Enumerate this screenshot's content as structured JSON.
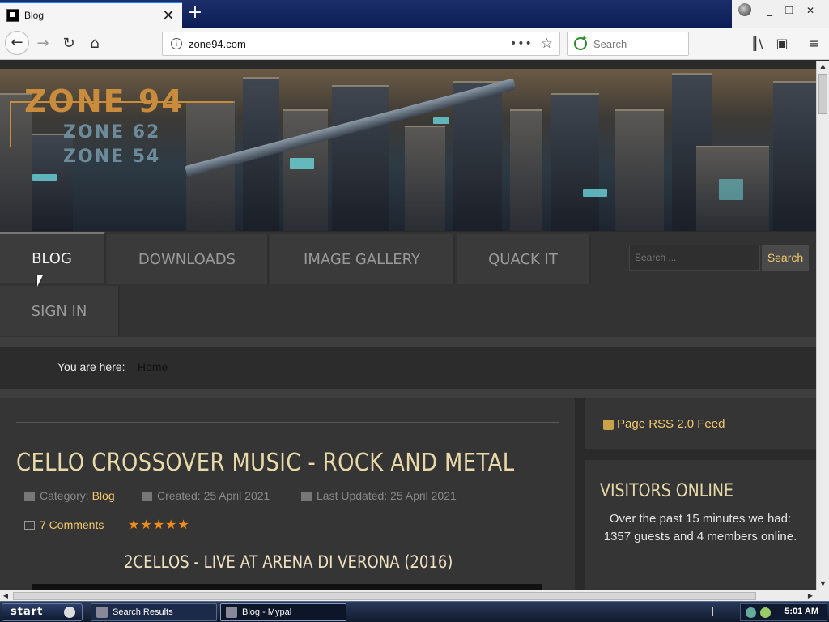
{
  "browser": {
    "tab_title": "Blog",
    "tab_close": "✕",
    "newtab": "+",
    "url": "zone94.com",
    "url_menu": "•••",
    "search_placeholder": "Search",
    "window_controls": [
      "_",
      "❐",
      "✕"
    ]
  },
  "site": {
    "logo": {
      "main": "ZONE 94",
      "sub1": "ZONE 62",
      "sub2": "ZONE 54"
    },
    "menu": [
      "BLOG",
      "DOWNLOADS",
      "IMAGE GALLERY",
      "QUACK IT",
      "SIGN IN"
    ],
    "search": {
      "placeholder": "Search ...",
      "button": "Search"
    },
    "breadcrumb": {
      "label": "You are here:",
      "current": "Home"
    }
  },
  "article": {
    "title": "CELLO CROSSOVER MUSIC - ROCK AND METAL",
    "category_label": "Category:",
    "category": "Blog",
    "created": "Created: 25 April 2021",
    "updated": "Last Updated: 25 April 2021",
    "comments": "7 Comments",
    "rating_stars": "★★★★★",
    "rating": 5,
    "video_title": "2CELLOS - LIVE AT ARENA DI VERONA (2016)"
  },
  "sidebar": {
    "rss": "Page RSS 2.0 Feed",
    "visitors_title": "VISITORS ONLINE",
    "visitors_text": "Over the past 15 minutes we had: 1357 guests and 4 members online."
  },
  "taskbar": {
    "start": "start",
    "items": [
      "Search Results",
      "Blog - Mypal"
    ],
    "clock": "5:01 AM"
  },
  "colors": {
    "accent": "#f2c96c",
    "title": "#e8d9a8",
    "star": "#f08c1a"
  }
}
